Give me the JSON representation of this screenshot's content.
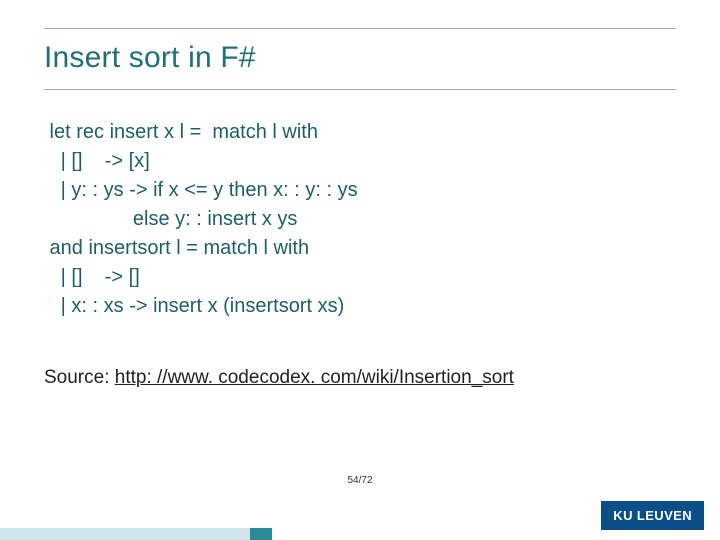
{
  "title": "Insert sort in F#",
  "code": {
    "l1": " let rec insert x l =  match l with",
    "l2": "   | []    -> [x]",
    "l3": "   | y: : ys -> if x <= y then x: : y: : ys",
    "l4": "                else y: : insert x ys",
    "l5": " and insertsort l = match l with",
    "l6": "   | []    -> []",
    "l7": "   | x: : xs -> insert x (insertsort xs)"
  },
  "source": {
    "label": "Source: ",
    "url_text": "http: //www. codecodex. com/wiki/Insertion_sort",
    "url_href": "http://www.codecodex.com/wiki/Insertion_sort"
  },
  "page": "54/72",
  "brand": "KU LEUVEN"
}
